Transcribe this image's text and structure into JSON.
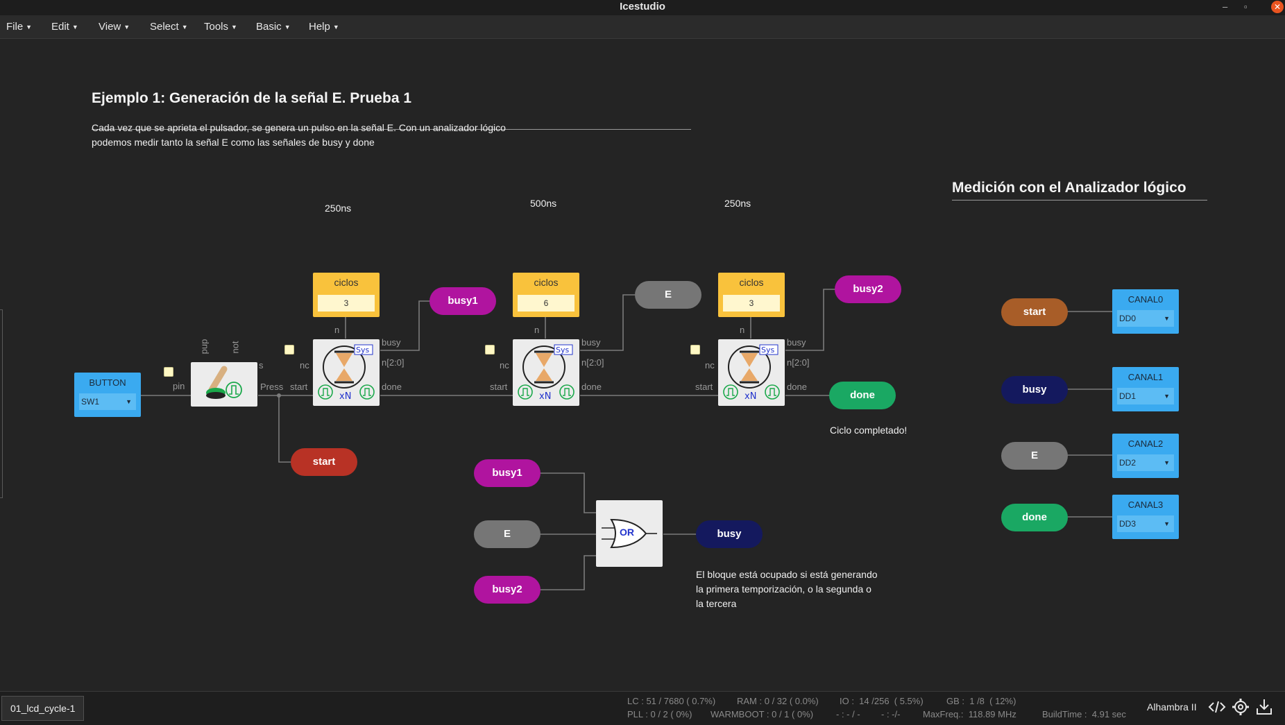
{
  "window": {
    "title": "Icestudio",
    "controls": [
      "–",
      "▫",
      "✕"
    ]
  },
  "menu": [
    {
      "label": "File"
    },
    {
      "label": "Edit"
    },
    {
      "label": "View"
    },
    {
      "label": "Select"
    },
    {
      "label": "Tools"
    },
    {
      "label": "Basic"
    },
    {
      "label": "Help"
    }
  ],
  "canvas": {
    "example_title": "Ejemplo 1: Generación de la señal E. Prueba 1",
    "description": [
      "Cada vez que se aprieta el pulsador, se genera un pulso en la señal E. Con un analizador lógico",
      "podemos medir tanto la señal E como las señales de busy y done"
    ],
    "analyzer_title": "Medición con el Analizador lógico",
    "durations": [
      "250ns",
      "500ns",
      "250ns"
    ],
    "constants": [
      {
        "label": "ciclos",
        "value": "3"
      },
      {
        "label": "ciclos",
        "value": "6"
      },
      {
        "label": "ciclos",
        "value": "3"
      }
    ],
    "button_block": {
      "label": "BUTTON",
      "pin": "SW1"
    },
    "button_ports": {
      "in": "pin",
      "out": "Press",
      "pup": "pup",
      "not": "not",
      "s": "s"
    },
    "timer_ports": {
      "n": "n",
      "nc": "nc",
      "start": "start",
      "busy": "busy",
      "n20": "n[2:0]",
      "done": "done",
      "xN": "xN",
      "sys": "Sys"
    },
    "labels": {
      "busy1": "busy1",
      "busy2": "busy2",
      "E": "E",
      "done": "done",
      "start": "start",
      "busy": "busy"
    },
    "or_gate": "OR",
    "done_note": "Ciclo completado!",
    "busy_note": [
      "El bloque está ocupado si está generando",
      "la primera temporización, o la segunda o",
      "la tercera"
    ],
    "analyzer": [
      {
        "signal": "start",
        "channel": "CANAL0",
        "pin": "DD0",
        "color": "#a85d28"
      },
      {
        "signal": "busy",
        "channel": "CANAL1",
        "pin": "DD1",
        "color": "#14195e"
      },
      {
        "signal": "E",
        "channel": "CANAL2",
        "pin": "DD2",
        "color": "#767676"
      },
      {
        "signal": "done",
        "channel": "CANAL3",
        "pin": "DD3",
        "color": "#1aa863"
      }
    ],
    "colors": {
      "magenta": "#b0149f",
      "grey": "#767676",
      "green": "#1aa863",
      "red": "#b83225",
      "navy": "#14195e",
      "const": "#f9c23c",
      "io": "#3aaaf0"
    }
  },
  "status": {
    "file": "01_lcd_cycle-1",
    "lc": "LC : 51 / 7680 ( 0.7%)",
    "pll": "PLL : 0 / 2 ( 0%)",
    "ram": "RAM : 0 / 32 ( 0.0%)",
    "warmboot": "WARMBOOT : 0 / 1 ( 0%)",
    "io": "IO :  14 /256  ( 5.5%)",
    "io2": "- : - / -",
    "gb": "GB :  1 /8  ( 12%)",
    "gb2": "- : -/-",
    "maxfreq": "MaxFreq.:  118.89 MHz",
    "buildtime": "BuildTime :  4.91 sec",
    "board": "Alhambra II"
  }
}
